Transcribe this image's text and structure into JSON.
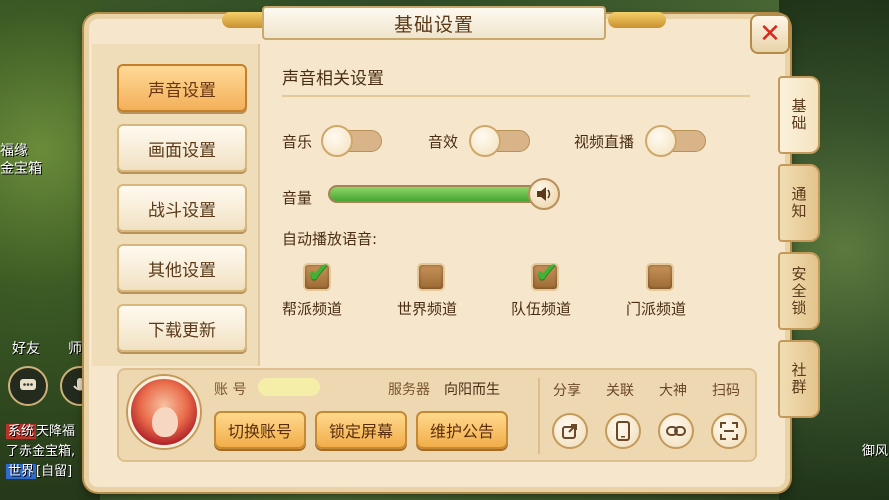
{
  "title": "基础设置",
  "menu": [
    "声音设置",
    "画面设置",
    "战斗设置",
    "其他设置",
    "下载更新"
  ],
  "side_tabs": [
    "基础",
    "通知",
    "安全锁",
    "社群"
  ],
  "sound": {
    "section_title": "声音相关设置",
    "music_label": "音乐",
    "sfx_label": "音效",
    "live_label": "视频直播",
    "volume_label": "音量",
    "volume_level": 0.95,
    "auto_voice_label": "自动播放语音:"
  },
  "channels": [
    {
      "label": "帮派频道",
      "checked": true
    },
    {
      "label": "世界频道",
      "checked": false
    },
    {
      "label": "队伍频道",
      "checked": true
    },
    {
      "label": "门派频道",
      "checked": false
    }
  ],
  "account": {
    "account_label": "账  号",
    "server_label": "服务器",
    "server_value": "向阳而生",
    "switch_label": "切换账号",
    "lock_label": "锁定屏幕",
    "notice_label": "维护公告"
  },
  "share": [
    "分享",
    "关联",
    "大神",
    "扫码"
  ],
  "background": {
    "left_text_1": "福缘",
    "left_text_2": "金宝箱",
    "friend_label": "好友",
    "master_label": "师",
    "chat_line_1_tag": "系统",
    "chat_line_1": "天降福",
    "chat_line_2": "了赤金宝箱,",
    "chat_line_3_tag": "世界",
    "chat_line_3": "[自留]",
    "right_text": "御风"
  },
  "colors": {
    "accent_orange": "#f2ad4a",
    "close_red": "#d8281f",
    "check_green": "#3fb336",
    "volume_green": "#46a532"
  }
}
